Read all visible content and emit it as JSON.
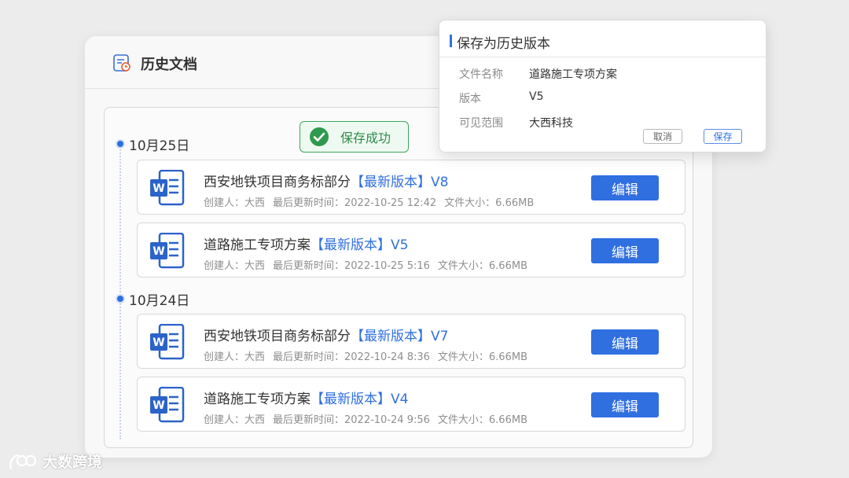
{
  "panel": {
    "title": "历史文档",
    "icon": "document-history-icon"
  },
  "toast": {
    "text": "保存成功",
    "icon": "check-circle-icon",
    "color": "#3ea65b"
  },
  "groups": [
    {
      "date": "10月25日",
      "items": [
        {
          "name": "西安地铁项目商务标部分",
          "tag": "【最新版本】",
          "version": "V8",
          "creator": "创建人：大西",
          "updated": "最后更新时间：2022-10-25 12:42",
          "size": "文件大小：6.66MB",
          "action": "编辑"
        },
        {
          "name": "道路施工专项方案",
          "tag": "【最新版本】",
          "version": "V5",
          "creator": "创建人：大西",
          "updated": "最后更新时间：2022-10-25 5:16",
          "size": "文件大小：6.66MB",
          "action": "编辑"
        }
      ]
    },
    {
      "date": "10月24日",
      "items": [
        {
          "name": "西安地铁项目商务标部分",
          "tag": "【最新版本】",
          "version": "V7",
          "creator": "创建人：大西",
          "updated": "最后更新时间：2022-10-24 8:36",
          "size": "文件大小：6.66MB",
          "action": "编辑"
        },
        {
          "name": "道路施工专项方案",
          "tag": "【最新版本】",
          "version": "V4",
          "creator": "创建人：大西",
          "updated": "最后更新时间：2022-10-24 9:56",
          "size": "文件大小：6.66MB",
          "action": "编辑"
        }
      ]
    }
  ],
  "dialog": {
    "title": "保存为历史版本",
    "fields": [
      {
        "label": "文件名称",
        "value": "道路施工专项方案"
      },
      {
        "label": "版本",
        "value": "V5"
      },
      {
        "label": "可见范围",
        "value": "大西科技"
      }
    ],
    "cancel": "取消",
    "save": "保存"
  },
  "watermark": {
    "text": "大数跨境"
  },
  "colors": {
    "accent": "#2f6fe0",
    "word_icon": "#2b63c9",
    "success": "#3ea65b",
    "background": "#ececec"
  }
}
